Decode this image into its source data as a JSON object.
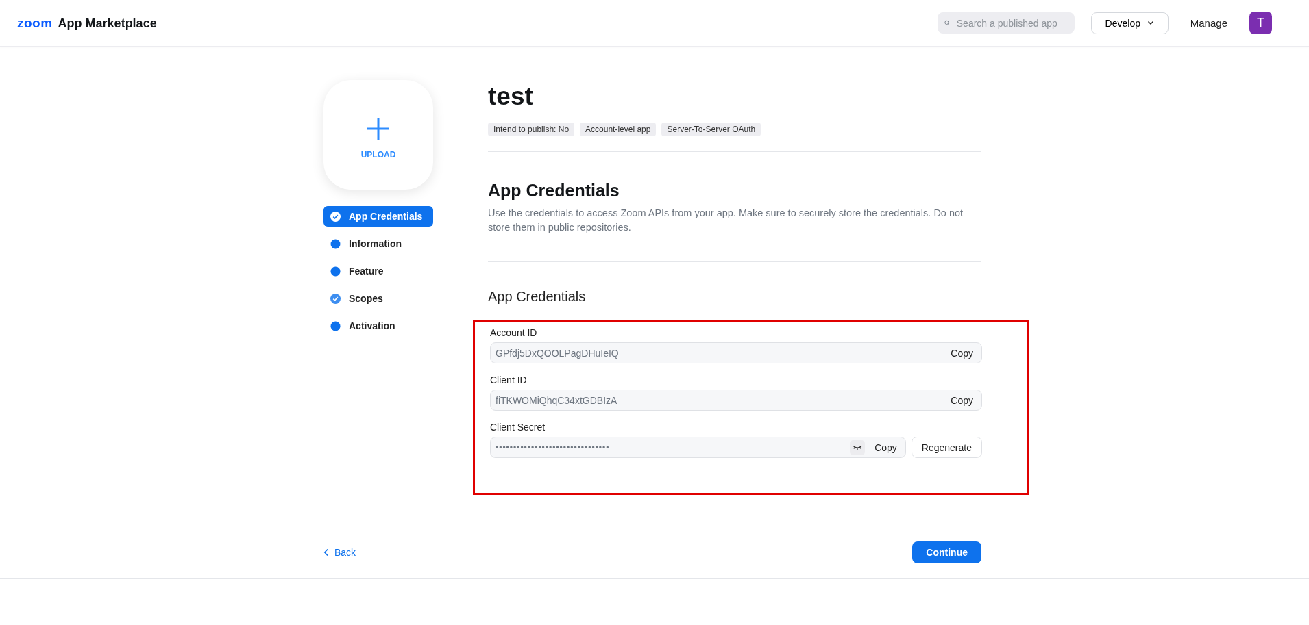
{
  "header": {
    "logo": "zoom",
    "title": "App Marketplace",
    "search": {
      "placeholder": "Search a published app"
    },
    "develop": "Develop",
    "manage": "Manage",
    "avatar": "T"
  },
  "upload": {
    "label": "UPLOAD"
  },
  "steps": [
    {
      "label": "App Credentials",
      "selected": true,
      "checked": true
    },
    {
      "label": "Information",
      "selected": false,
      "checked": false
    },
    {
      "label": "Feature",
      "selected": false,
      "checked": false
    },
    {
      "label": "Scopes",
      "selected": false,
      "checked": true
    },
    {
      "label": "Activation",
      "selected": false,
      "checked": false
    }
  ],
  "app": {
    "name": "test",
    "tags": [
      "Intend to publish: No",
      "Account-level app",
      "Server-To-Server OAuth"
    ]
  },
  "section": {
    "title": "App Credentials",
    "description": "Use the credentials to access Zoom APIs from your app. Make sure to securely store the credentials. Do not store them in public repositories."
  },
  "credentials": {
    "title": "App Credentials",
    "highlighted": true,
    "fields": [
      {
        "kind": "plain",
        "label": "Account ID",
        "value": "GPfdj5DxQOOLPagDHuIeIQ",
        "copy": "Copy"
      },
      {
        "kind": "plain",
        "label": "Client ID",
        "value": "fiTKWOMiQhqC34xtGDBIzA",
        "copy": "Copy"
      },
      {
        "kind": "secret",
        "label": "Client Secret",
        "value": "••••••••••••••••••••••••••••••••",
        "copy": "Copy",
        "regenerate": "Regenerate"
      }
    ]
  },
  "footer": {
    "back": "Back",
    "continue": "Continue"
  }
}
